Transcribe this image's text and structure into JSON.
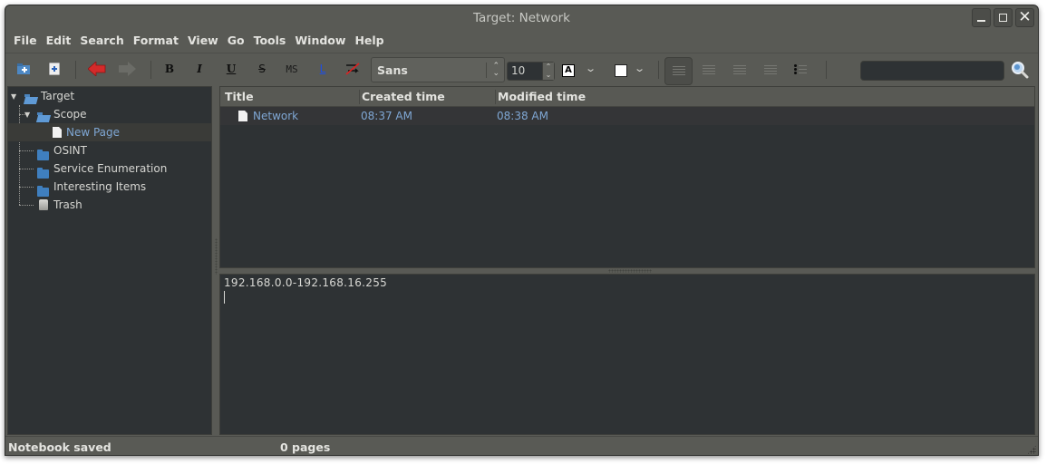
{
  "window": {
    "title": "Target: Network",
    "controls": {
      "minimize": "minimize-icon",
      "maximize": "maximize-icon",
      "close": "close-icon"
    }
  },
  "menubar": {
    "items": [
      "File",
      "Edit",
      "Search",
      "Format",
      "View",
      "Go",
      "Tools",
      "Window",
      "Help"
    ]
  },
  "toolbar": {
    "new_folder": "new-folder-icon",
    "new_page": "new-page-icon",
    "back": "back-arrow-icon",
    "forward": "forward-arrow-icon",
    "bold_label": "B",
    "italic_label": "I",
    "underline_label": "U",
    "strike_label": "S",
    "mono_label": "MS",
    "link_label": "L",
    "clear_format": "clear-format-icon",
    "font_family": "Sans",
    "font_size": "10",
    "text_color_label": "A",
    "align_options": [
      "left",
      "center",
      "right",
      "justify"
    ],
    "bullet_list": "bullet-list-icon",
    "search_value": "",
    "search_icon": "search-icon",
    "colors": {
      "back_arrow": "#d42a2a",
      "link": "#1f4fe0",
      "clear_slash": "#e02020"
    }
  },
  "tree": {
    "items": [
      {
        "label": "Target",
        "type": "folder-open",
        "expanded": true,
        "depth": 0
      },
      {
        "label": "Scope",
        "type": "folder-open",
        "expanded": true,
        "depth": 1
      },
      {
        "label": "New Page",
        "type": "page",
        "depth": 2,
        "selected": true
      },
      {
        "label": "OSINT",
        "type": "folder",
        "depth": 1
      },
      {
        "label": "Service Enumeration",
        "type": "folder",
        "depth": 1
      },
      {
        "label": "Interesting Items",
        "type": "folder",
        "depth": 1
      },
      {
        "label": "Trash",
        "type": "trash",
        "depth": 1
      }
    ]
  },
  "list": {
    "columns": [
      "Title",
      "Created time",
      "Modified time"
    ],
    "rows": [
      {
        "title": "Network",
        "created": "08:37 AM",
        "modified": "08:38 AM"
      }
    ]
  },
  "editor": {
    "lines": [
      "192.168.0.0-192.168.16.255",
      ""
    ]
  },
  "status": {
    "message": "Notebook saved",
    "pages": "0 pages"
  }
}
